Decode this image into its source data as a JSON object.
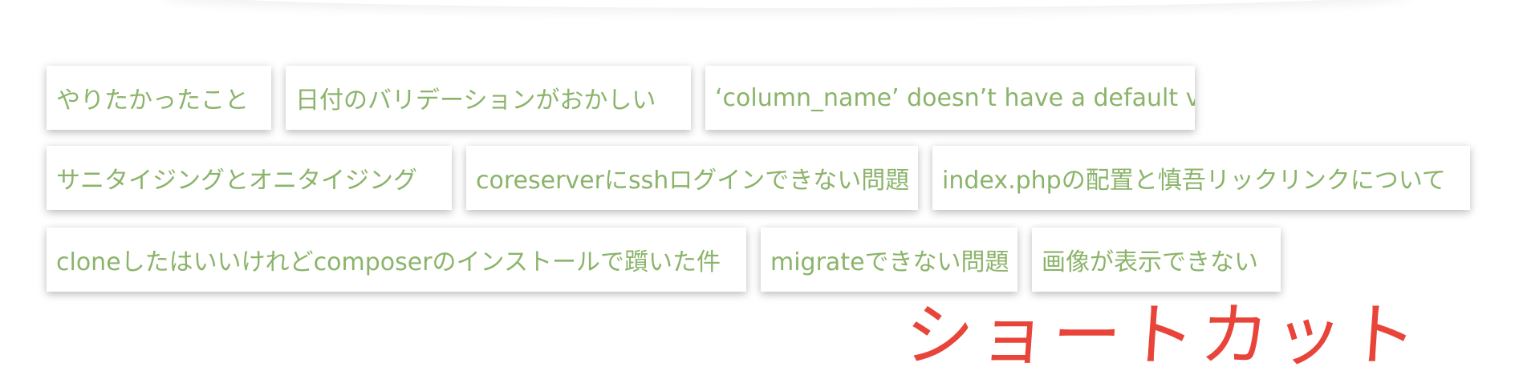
{
  "tags": [
    "やりたかったこと",
    "日付のバリデーションがおかしい",
    "‘column_name’ doesn’t have a default value",
    "サニタイジングとオニタイジング",
    "coreserverにsshログインできない問題",
    "index.phpの配置と慎吾リックリンクについて",
    "cloneしたはいいけれどcomposerのインストールで躓いた件",
    "migrateできない問題",
    "画像が表示できない"
  ],
  "annotation": "ショートカット",
  "colors": {
    "tag_text": "#8bb46a",
    "annotation": "#e8443a",
    "background": "#ffffff"
  }
}
